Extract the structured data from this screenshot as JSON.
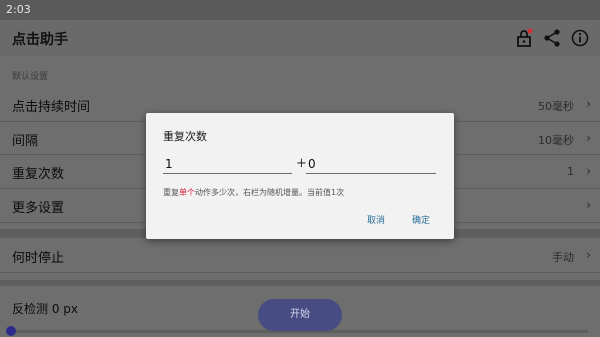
{
  "statusbar": {
    "time": "2:03"
  },
  "appbar": {
    "title": "点击助手",
    "icons": [
      "lock-icon",
      "share-icon",
      "info-icon"
    ],
    "lock_badge_color": "#d32f2f"
  },
  "section": {
    "title": "默认设置"
  },
  "settings": [
    {
      "label": "点击持续时间",
      "value": "50毫秒"
    },
    {
      "label": "间隔",
      "value": "10毫秒"
    },
    {
      "label": "重复次数",
      "value": "1"
    },
    {
      "label": "更多设置",
      "value": ""
    },
    {
      "label": "何时停止",
      "value": "手动"
    }
  ],
  "anti_detect": {
    "label": "反检测 0 px"
  },
  "start_button": {
    "label": "开始"
  },
  "dialog": {
    "title": "重复次数",
    "field1_value": "1",
    "plus": "+",
    "field2_value": "0",
    "desc_prefix": "重复",
    "desc_highlight": "单个",
    "desc_suffix": "动作多少次，右栏为随机增量。当前值1次",
    "cancel_label": "取消",
    "ok_label": "确定"
  },
  "colors": {
    "accent": "#2b6f9a",
    "highlight": "#d2193a",
    "fab": "#474c83"
  }
}
